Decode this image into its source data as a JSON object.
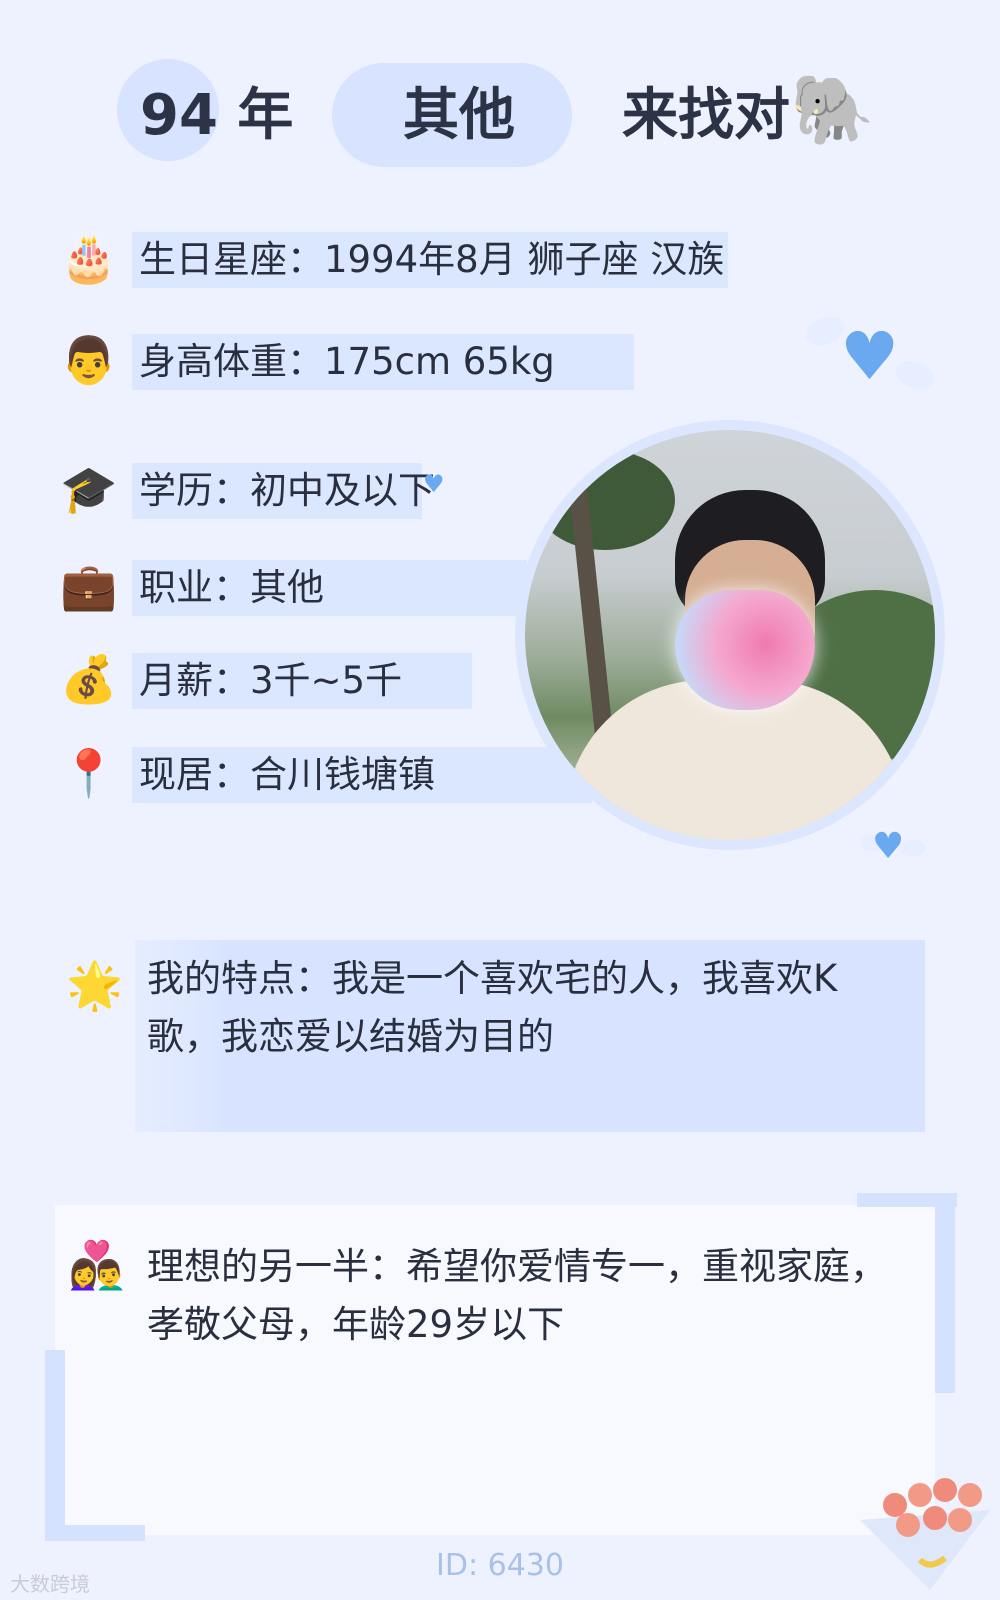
{
  "header": {
    "year": "94 年",
    "category": "其他",
    "slogan": "来找对",
    "slogan_icon": "🐘"
  },
  "info": [
    {
      "icon": "🎂",
      "icon_name": "cake-icon",
      "label": "生日星座：1994年8月 狮子座 汉族"
    },
    {
      "icon": "👨",
      "icon_name": "man-icon",
      "label": "身高体重：175cm 65kg"
    },
    {
      "icon": "🎓",
      "icon_name": "graduation-cap-icon",
      "label": "学历：初中及以下"
    },
    {
      "icon": "💼",
      "icon_name": "briefcase-icon",
      "label": "职业：其他"
    },
    {
      "icon": "💰",
      "icon_name": "money-bag-icon",
      "label": "月薪：3千~5千"
    },
    {
      "icon": "📍",
      "icon_name": "location-pin-icon",
      "label": "现居：合川钱塘镇"
    }
  ],
  "feature": {
    "icon": "🌟",
    "text": "我的特点：我是一个喜欢宅的人，我喜欢K歌，我恋爱以结婚为目的"
  },
  "ideal": {
    "icon": "👩‍❤️‍👨",
    "text": "理想的另一半：希望你爱情专一，重视家庭，孝敬父母，年龄29岁以下"
  },
  "footer": {
    "id": "ID: 6430",
    "watermark": "大数跨境"
  },
  "colors": {
    "background": "#eef2ff",
    "highlight": "#d8e4ff",
    "accent_heart": "#6aa8f0"
  }
}
